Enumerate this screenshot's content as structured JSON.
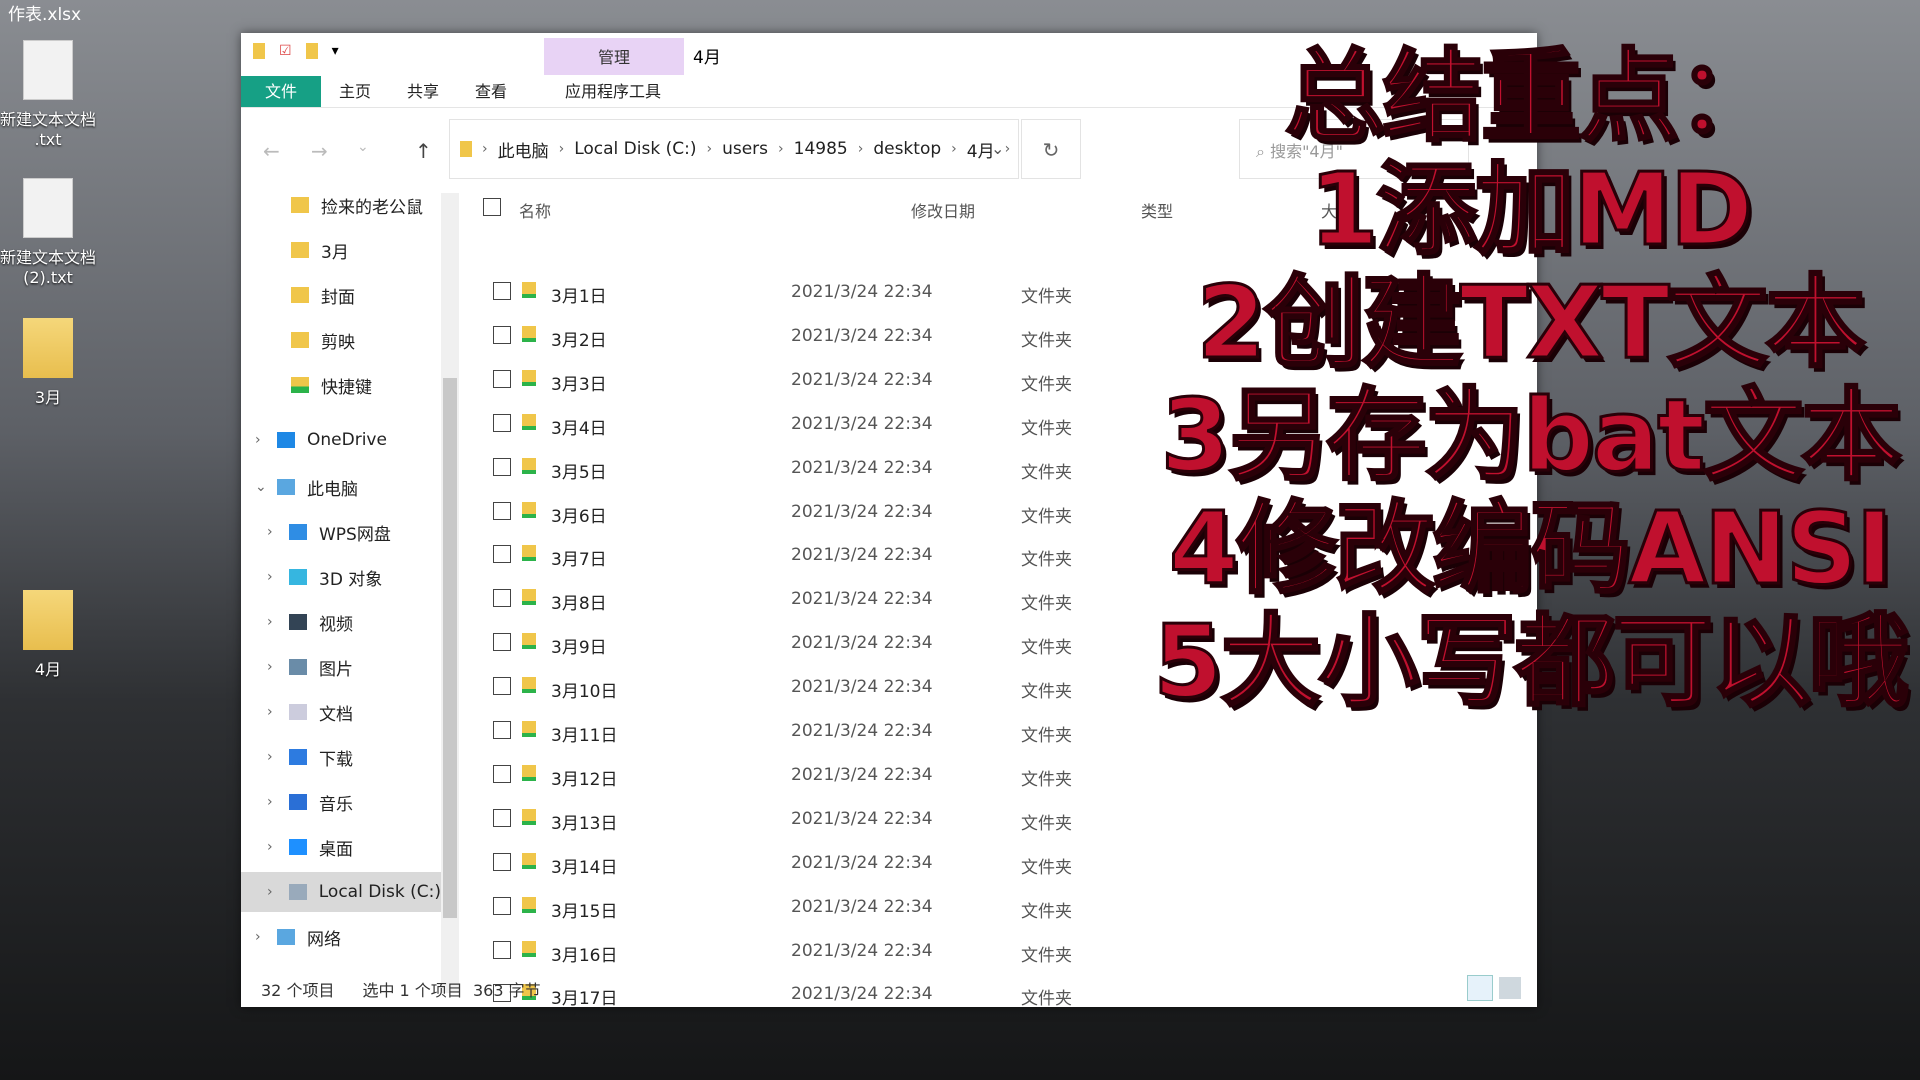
{
  "desktop": {
    "top_file": "作表.xlsx",
    "icons": [
      {
        "label": "新建文本文档\n.txt"
      },
      {
        "label": "新建文本文档\n(2).txt"
      },
      {
        "label": "3月"
      },
      {
        "label": "4月"
      }
    ]
  },
  "window": {
    "title": "4月",
    "context_tab": "管理",
    "ribbon_tabs": [
      "文件",
      "主页",
      "共享",
      "查看",
      "应用程序工具"
    ],
    "breadcrumb": [
      "此电脑",
      "Local Disk (C:)",
      "users",
      "14985",
      "desktop",
      "4月"
    ],
    "search_placeholder": "搜索\"4月\""
  },
  "nav_pane": {
    "quick": [
      "捡来的老公鼠",
      "3月",
      "封面",
      "剪映",
      "快捷键"
    ],
    "onedrive": "OneDrive",
    "this_pc": "此电脑",
    "pc_items": [
      "WPS网盘",
      "3D 对象",
      "视频",
      "图片",
      "文档",
      "下载",
      "音乐",
      "桌面",
      "Local Disk (C:)"
    ],
    "network": "网络"
  },
  "columns": {
    "name": "名称",
    "date": "修改日期",
    "type": "类型",
    "size": "大小"
  },
  "files": [
    {
      "name": "3月1日",
      "date": "2021/3/24 22:34",
      "type": "文件夹"
    },
    {
      "name": "3月2日",
      "date": "2021/3/24 22:34",
      "type": "文件夹"
    },
    {
      "name": "3月3日",
      "date": "2021/3/24 22:34",
      "type": "文件夹"
    },
    {
      "name": "3月4日",
      "date": "2021/3/24 22:34",
      "type": "文件夹"
    },
    {
      "name": "3月5日",
      "date": "2021/3/24 22:34",
      "type": "文件夹"
    },
    {
      "name": "3月6日",
      "date": "2021/3/24 22:34",
      "type": "文件夹"
    },
    {
      "name": "3月7日",
      "date": "2021/3/24 22:34",
      "type": "文件夹"
    },
    {
      "name": "3月8日",
      "date": "2021/3/24 22:34",
      "type": "文件夹"
    },
    {
      "name": "3月9日",
      "date": "2021/3/24 22:34",
      "type": "文件夹"
    },
    {
      "name": "3月10日",
      "date": "2021/3/24 22:34",
      "type": "文件夹"
    },
    {
      "name": "3月11日",
      "date": "2021/3/24 22:34",
      "type": "文件夹"
    },
    {
      "name": "3月12日",
      "date": "2021/3/24 22:34",
      "type": "文件夹"
    },
    {
      "name": "3月13日",
      "date": "2021/3/24 22:34",
      "type": "文件夹"
    },
    {
      "name": "3月14日",
      "date": "2021/3/24 22:34",
      "type": "文件夹"
    },
    {
      "name": "3月15日",
      "date": "2021/3/24 22:34",
      "type": "文件夹"
    },
    {
      "name": "3月16日",
      "date": "2021/3/24 22:34",
      "type": "文件夹"
    },
    {
      "name": "3月17日",
      "date": "2021/3/24 22:34",
      "type": "文件夹"
    }
  ],
  "status": {
    "count": "32 个项目",
    "selected": "选中 1 个项目",
    "size": "363 字节"
  },
  "overlay": [
    "总结重点：",
    "1添加MD",
    "2创建TXT文本",
    "3另存为bat文本",
    "4修改编码ANSI",
    "5大小写都可以哦"
  ],
  "colors": {
    "file_tab": "#16a085",
    "context_tab": "#e8d3f5",
    "overlay_text": "#c0102e"
  }
}
